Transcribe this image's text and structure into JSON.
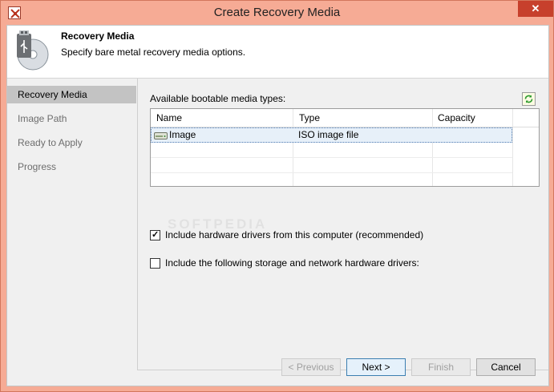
{
  "window": {
    "title": "Create Recovery Media",
    "close_label": "✕"
  },
  "header": {
    "title": "Recovery Media",
    "subtitle": "Specify bare metal recovery media options."
  },
  "nav": {
    "items": [
      {
        "label": "Recovery Media",
        "active": true
      },
      {
        "label": "Image Path",
        "active": false
      },
      {
        "label": "Ready to Apply",
        "active": false
      },
      {
        "label": "Progress",
        "active": false
      }
    ]
  },
  "media": {
    "label": "Available bootable media types:",
    "columns": [
      "Name",
      "Type",
      "Capacity"
    ],
    "rows": [
      {
        "name": "Image",
        "type": "ISO image file",
        "capacity": "",
        "selected": true
      }
    ]
  },
  "options": {
    "include_hardware_drivers": {
      "label": "Include hardware drivers from this computer (recommended)",
      "checked": true
    },
    "include_storage_drivers": {
      "label": "Include the following storage and network hardware drivers:",
      "checked": false
    }
  },
  "watermark": "SOFTPEDIA",
  "buttons": {
    "previous": "< Previous",
    "next": "Next >",
    "finish": "Finish",
    "cancel": "Cancel"
  },
  "colors": {
    "titlebar": "#f6ab95",
    "close_button": "#c7402c",
    "active_nav": "#c3c3c3",
    "selection": "#e7f0f9"
  }
}
